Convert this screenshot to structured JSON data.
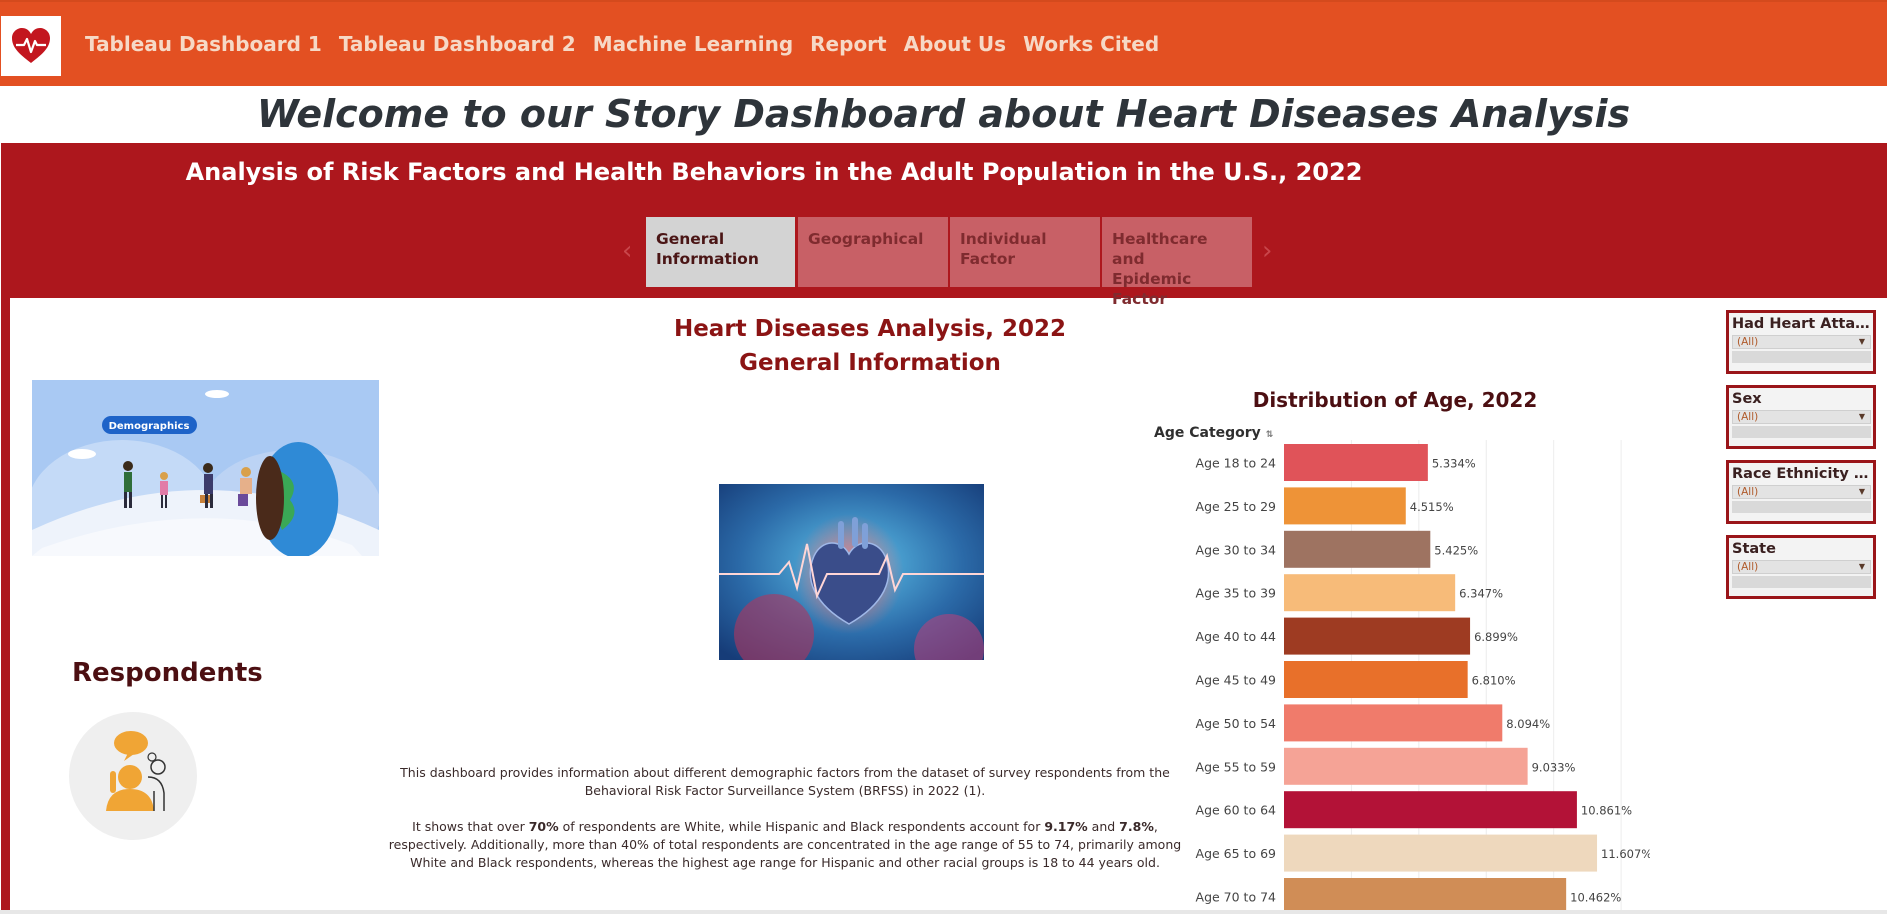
{
  "nav": {
    "links": [
      "Tableau Dashboard 1",
      "Tableau Dashboard 2",
      "Machine Learning",
      "Report",
      "About Us",
      "Works Cited"
    ]
  },
  "welcome": "Welcome to our Story Dashboard about Heart Diseases Analysis",
  "story": {
    "title": "Analysis of Risk Factors and Health Behaviors in the Adult Population in the U.S., 2022",
    "tabs": [
      {
        "line1": "General",
        "line2": "Information",
        "active": true
      },
      {
        "line1": "Geographical",
        "line2": "",
        "active": false
      },
      {
        "line1": "Individual Factor",
        "line2": "",
        "active": false
      },
      {
        "line1": "Healthcare and",
        "line2": "Epidemic Factor",
        "active": false
      }
    ],
    "prev_arrow": "‹",
    "next_arrow": "›"
  },
  "dashboard": {
    "title_line1": "Heart Diseases Analysis, 2022",
    "title_line2": "General Information",
    "demographics_tag": "Demographics",
    "respondents": "Respondents",
    "desc1": "This dashboard provides information about different demographic factors from the dataset of survey respondents from the Behavioral Risk Factor Surveillance System (BRFSS) in 2022 (1).",
    "desc2_a": "It shows that over ",
    "desc2_b": "70%",
    "desc2_c": " of respondents are White, while Hispanic and Black respondents account for ",
    "desc2_d": "9.17%",
    "desc2_e": " and ",
    "desc2_f": "7.8%",
    "desc2_g": ", respectively. Additionally, more than 40% of total respondents are concentrated in the age range of 55 to 74, primarily among White and Black respondents, whereas the highest age range for Hispanic and other racial groups is 18 to 44 years old."
  },
  "chart_data": {
    "type": "bar",
    "orientation": "horizontal",
    "title": "Distribution of Age, 2022",
    "ylabel": "Age Category",
    "categories": [
      "Age 18 to 24",
      "Age 25 to 29",
      "Age 30 to 34",
      "Age 35 to 39",
      "Age 40 to 44",
      "Age 45 to 49",
      "Age 50 to 54",
      "Age 55 to 59",
      "Age 60 to 64",
      "Age 65 to 69",
      "Age 70 to 74"
    ],
    "values": [
      5.334,
      4.515,
      5.425,
      6.347,
      6.899,
      6.81,
      8.094,
      9.033,
      10.861,
      11.607,
      10.462
    ],
    "value_labels": [
      "5.334%",
      "4.515%",
      "5.425%",
      "6.347%",
      "6.899%",
      "6.810%",
      "8.094%",
      "9.033%",
      "10.861%",
      "11.607%",
      "10.462%"
    ],
    "colors": [
      "#e05359",
      "#ee9337",
      "#9e7361",
      "#f7bb79",
      "#9e3b22",
      "#e8702a",
      "#f07b6b",
      "#f5a396",
      "#b31237",
      "#eed8bd",
      "#d08d56"
    ],
    "xlim": [
      0,
      13.2
    ],
    "grid": true
  },
  "filters": [
    {
      "label": "Had Heart Attack",
      "value": "(All)"
    },
    {
      "label": "Sex",
      "value": "(All)"
    },
    {
      "label": "Race Ethnicity Ca...",
      "value": "(All)"
    },
    {
      "label": "State",
      "value": "(All)"
    }
  ],
  "colors": {
    "nav_bg": "#e35022",
    "banner_bg": "#ad171d",
    "title_red": "#8b1414"
  }
}
